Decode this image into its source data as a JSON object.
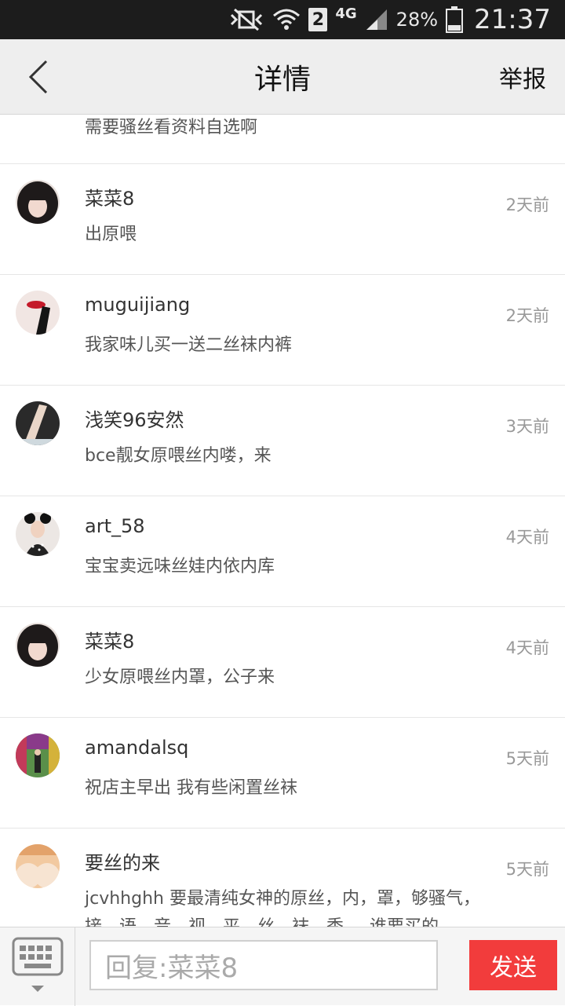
{
  "status_bar": {
    "sim_slot": "2",
    "network": "4G",
    "battery": "28%",
    "time": "21:37"
  },
  "header": {
    "title": "详情",
    "report_label": "举报"
  },
  "partial_top_message": "需要骚丝看资料自选啊",
  "comments": [
    {
      "name": "菜菜8",
      "message": "出原喂",
      "time": "2天前",
      "avatar": "dark-hair"
    },
    {
      "name": "muguijiang",
      "message": "我家味儿买一送二丝袜内裤",
      "time": "2天前",
      "avatar": "lips"
    },
    {
      "name": "浅笑96安然",
      "message": "bce靓女原喂丝内喽，来",
      "time": "3天前",
      "avatar": "legs"
    },
    {
      "name": "art_58",
      "message": "宝宝卖远味丝娃内依内库",
      "time": "4天前",
      "avatar": "mouse-ears"
    },
    {
      "name": "菜菜8",
      "message": "少女原喂丝内罩，公子来",
      "time": "4天前",
      "avatar": "dark-hair"
    },
    {
      "name": "amandalsq",
      "message": "祝店主早出 我有些闲置丝袜",
      "time": "5天前",
      "avatar": "colorful"
    },
    {
      "name": "要丝的来",
      "message": "jcvhhghh 要最清纯女神的原丝，内，罩，够骚气，接，语，音，视，平，丝，袜，秀，，谁要买的",
      "time": "5天前",
      "avatar": "peach"
    }
  ],
  "input_bar": {
    "placeholder": "回复:菜菜8",
    "send_label": "发送"
  }
}
